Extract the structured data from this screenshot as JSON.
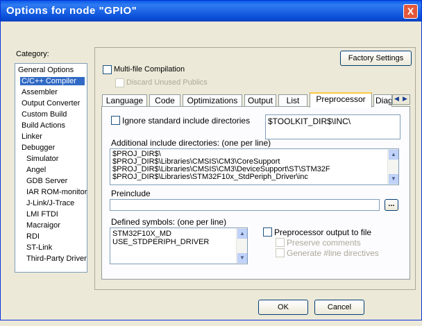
{
  "window": {
    "title": "Options for node \"GPIO\"",
    "close_glyph": "X"
  },
  "sidebar": {
    "label": "Category:",
    "items": [
      "General Options",
      "C/C++ Compiler",
      "Assembler",
      "Output Converter",
      "Custom Build",
      "Build Actions",
      "Linker",
      "Debugger",
      "Simulator",
      "Angel",
      "GDB Server",
      "IAR ROM-monitor",
      "J-Link/J-Trace",
      "LMI FTDI",
      "Macraigor",
      "RDI",
      "ST-Link",
      "Third-Party Driver"
    ],
    "selected_index": 1
  },
  "panel": {
    "factory_settings": "Factory Settings",
    "multifile_label": "Multi-file Compilation",
    "discard_label": "Discard Unused Publics"
  },
  "tabs": [
    "Language",
    "Code",
    "Optimizations",
    "Output",
    "List",
    "Preprocessor",
    "Diag"
  ],
  "active_tab": "Preprocessor",
  "preprocessor": {
    "ignore_label": "Ignore standard include directories",
    "toolkit_value": "$TOOLKIT_DIR$\\INC\\",
    "additional_label": "Additional include directories: (one per line)",
    "include_dirs": [
      "$PROJ_DIR$\\",
      "$PROJ_DIR$\\Libraries\\CMSIS\\CM3\\CoreSupport",
      "$PROJ_DIR$\\Libraries\\CMSIS\\CM3\\DeviceSupport\\ST\\STM32F",
      "$PROJ_DIR$\\Libraries\\STM32F10x_StdPeriph_Driver\\inc"
    ],
    "preinclude_label": "Preinclude",
    "preinclude_value": "",
    "browse_label": "...",
    "defined_label": "Defined symbols: (one per line)",
    "defined_symbols": [
      "STM32F10X_MD",
      "USE_STDPERIPH_DRIVER"
    ],
    "pp_output_label": "Preprocessor output to file",
    "preserve_label": "Preserve comments",
    "generate_label": "Generate #line directives"
  },
  "footer": {
    "ok": "OK",
    "cancel": "Cancel"
  },
  "colors": {
    "titlebar": "#0a5be8",
    "selection": "#316ac5",
    "tab_highlight": "#ffc83c"
  }
}
